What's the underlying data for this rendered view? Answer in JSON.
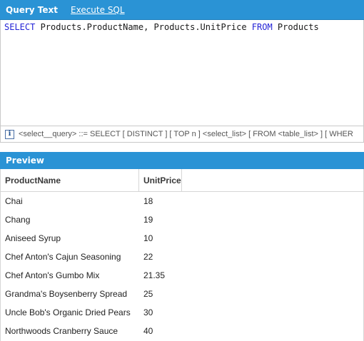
{
  "tabs": {
    "query_text": "Query Text",
    "execute_sql": "Execute SQL"
  },
  "editor": {
    "tokens": [
      {
        "text": "SELECT",
        "type": "kw"
      },
      {
        "text": " Products.ProductName, Products.UnitPrice ",
        "type": "id"
      },
      {
        "text": "FROM",
        "type": "kw"
      },
      {
        "text": " Products",
        "type": "id"
      }
    ]
  },
  "hint": {
    "icon": "info-icon",
    "text": "<select__query> ::= SELECT [ DISTINCT ] [ TOP n ] <select_list> [ FROM <table_list> ] [ WHER"
  },
  "preview": {
    "title": "Preview",
    "columns": [
      "ProductName",
      "UnitPrice"
    ],
    "rows": [
      [
        "Chai",
        "18"
      ],
      [
        "Chang",
        "19"
      ],
      [
        "Aniseed Syrup",
        "10"
      ],
      [
        "Chef Anton's Cajun Seasoning",
        "22"
      ],
      [
        "Chef Anton's Gumbo Mix",
        "21.35"
      ],
      [
        "Grandma's Boysenberry Spread",
        "25"
      ],
      [
        "Uncle Bob's Organic Dried Pears",
        "30"
      ],
      [
        "Northwoods Cranberry Sauce",
        "40"
      ]
    ]
  },
  "colors": {
    "accent": "#2a93d5",
    "keyword": "#2323d6"
  }
}
